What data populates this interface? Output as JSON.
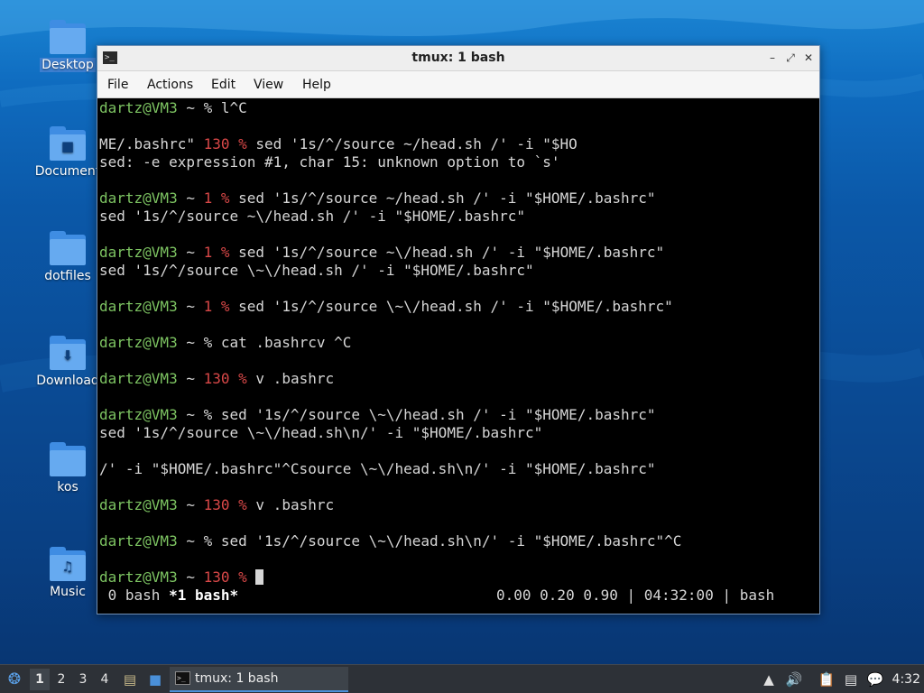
{
  "desktop": {
    "icons": [
      {
        "label": "Desktop",
        "icon": "desktop-folder-icon"
      },
      {
        "label": "Document",
        "icon": "documents-folder-icon"
      },
      {
        "label": "dotfiles",
        "icon": "folder-icon"
      },
      {
        "label": "Download",
        "icon": "downloads-folder-icon"
      },
      {
        "label": "kos",
        "icon": "folder-icon"
      },
      {
        "label": "Music",
        "icon": "music-folder-icon"
      }
    ]
  },
  "window": {
    "title": "tmux: 1 bash",
    "menu": [
      "File",
      "Actions",
      "Edit",
      "View",
      "Help"
    ]
  },
  "terminal": {
    "lines": [
      [
        {
          "t": "dartz@VM3",
          "c": "green"
        },
        {
          "t": " ~ % l^C",
          "c": "white"
        }
      ],
      [],
      [
        {
          "t": "ME/.bashrc\" ",
          "c": "white"
        },
        {
          "t": "130 %",
          "c": "red"
        },
        {
          "t": " sed '1s/^/source ~/head.sh /' -i \"$HO",
          "c": "white"
        }
      ],
      [
        {
          "t": "sed: -e expression #1, char 15: unknown option to `s'",
          "c": "white"
        }
      ],
      [],
      [
        {
          "t": "dartz@VM3",
          "c": "green"
        },
        {
          "t": " ~ ",
          "c": "white"
        },
        {
          "t": "1 %",
          "c": "red"
        },
        {
          "t": " sed '1s/^/source ~/head.sh /' -i \"$HOME/.bashrc\"",
          "c": "white"
        }
      ],
      [
        {
          "t": "sed '1s/^/source ~\\/head.sh /' -i \"$HOME/.bashrc\"",
          "c": "white"
        }
      ],
      [],
      [
        {
          "t": "dartz@VM3",
          "c": "green"
        },
        {
          "t": " ~ ",
          "c": "white"
        },
        {
          "t": "1 %",
          "c": "red"
        },
        {
          "t": " sed '1s/^/source ~\\/head.sh /' -i \"$HOME/.bashrc\"",
          "c": "white"
        }
      ],
      [
        {
          "t": "sed '1s/^/source \\~\\/head.sh /' -i \"$HOME/.bashrc\"",
          "c": "white"
        }
      ],
      [],
      [
        {
          "t": "dartz@VM3",
          "c": "green"
        },
        {
          "t": " ~ ",
          "c": "white"
        },
        {
          "t": "1 %",
          "c": "red"
        },
        {
          "t": " sed '1s/^/source \\~\\/head.sh /' -i \"$HOME/.bashrc\"",
          "c": "white"
        }
      ],
      [],
      [
        {
          "t": "dartz@VM3",
          "c": "green"
        },
        {
          "t": " ~ % cat .bashrcv ^C",
          "c": "white"
        }
      ],
      [],
      [
        {
          "t": "dartz@VM3",
          "c": "green"
        },
        {
          "t": " ~ ",
          "c": "white"
        },
        {
          "t": "130 %",
          "c": "red"
        },
        {
          "t": " v .bashrc",
          "c": "white"
        }
      ],
      [],
      [
        {
          "t": "dartz@VM3",
          "c": "green"
        },
        {
          "t": " ~ % sed '1s/^/source \\~\\/head.sh /' -i \"$HOME/.bashrc\"",
          "c": "white"
        }
      ],
      [
        {
          "t": "sed '1s/^/source \\~\\/head.sh\\n/' -i \"$HOME/.bashrc\"",
          "c": "white"
        }
      ],
      [],
      [
        {
          "t": "/' -i \"$HOME/.bashrc\"^Csource \\~\\/head.sh\\n/' -i \"$HOME/.bashrc\"",
          "c": "white"
        }
      ],
      [],
      [
        {
          "t": "dartz@VM3",
          "c": "green"
        },
        {
          "t": " ~ ",
          "c": "white"
        },
        {
          "t": "130 %",
          "c": "red"
        },
        {
          "t": " v .bashrc",
          "c": "white"
        }
      ],
      [],
      [
        {
          "t": "dartz@VM3",
          "c": "green"
        },
        {
          "t": " ~ % sed '1s/^/source \\~\\/head.sh\\n/' -i \"$HOME/.bashrc\"^C",
          "c": "white"
        }
      ],
      [],
      [
        {
          "t": "dartz@VM3",
          "c": "green"
        },
        {
          "t": " ~ ",
          "c": "white"
        },
        {
          "t": "130 %",
          "c": "red"
        },
        {
          "t": " ",
          "c": "white"
        }
      ]
    ],
    "status": {
      "window0": " 0 bash ",
      "window1": "*1 bash*",
      "right": "0.00 0.20 0.90 | 04:32:00 | bash"
    }
  },
  "taskbar": {
    "workspaces": [
      "1",
      "2",
      "3",
      "4"
    ],
    "active_workspace": "1",
    "task_label": "tmux: 1 bash",
    "clock": "4:32"
  },
  "colors": {
    "prompt_user": "#7dc462",
    "exit_code": "#d94848",
    "text": "#d6d6d6"
  }
}
